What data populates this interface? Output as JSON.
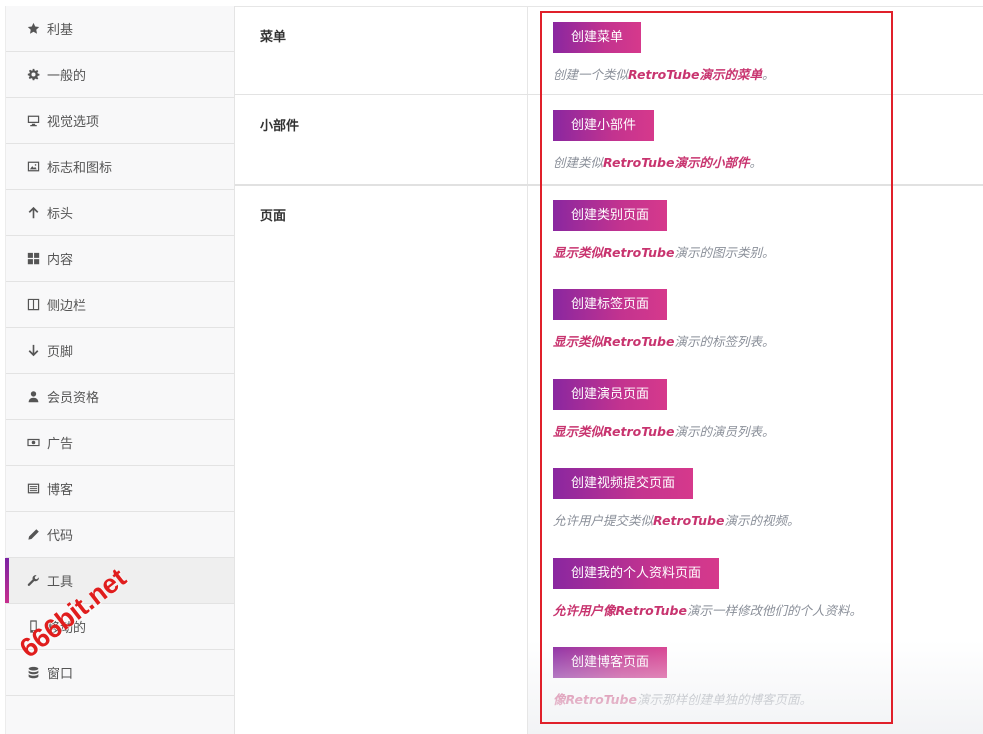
{
  "sidebar": {
    "items": [
      {
        "label": "利基",
        "icon": "star-icon"
      },
      {
        "label": "一般的",
        "icon": "gear-icon"
      },
      {
        "label": "视觉选项",
        "icon": "monitor-icon"
      },
      {
        "label": "标志和图标",
        "icon": "image-icon"
      },
      {
        "label": "标头",
        "icon": "arrow-up-icon"
      },
      {
        "label": "内容",
        "icon": "grid-icon"
      },
      {
        "label": "侧边栏",
        "icon": "columns-icon"
      },
      {
        "label": "页脚",
        "icon": "arrow-down-icon"
      },
      {
        "label": "会员资格",
        "icon": "user-icon"
      },
      {
        "label": "广告",
        "icon": "money-icon"
      },
      {
        "label": "博客",
        "icon": "list-icon"
      },
      {
        "label": "代码",
        "icon": "pencil-icon"
      },
      {
        "label": "工具",
        "icon": "wrench-icon",
        "active": true
      },
      {
        "label": "移动的",
        "icon": "mobile-icon"
      },
      {
        "label": "窗口",
        "icon": "database-icon"
      }
    ]
  },
  "sections": {
    "menu": {
      "label": "菜单",
      "button": "创建菜单",
      "desc_pre": "创建一个类似",
      "desc_hl": "RetroTube演示的菜单",
      "desc_post": "。"
    },
    "widgets": {
      "label": "小部件",
      "button": "创建小部件",
      "desc_pre": "创建类似",
      "desc_hl": "RetroTube演示的小部件",
      "desc_post": "。"
    },
    "pages": {
      "label": "页面",
      "items": [
        {
          "button": "创建类别页面",
          "desc_pre": "",
          "desc_hl": "显示类似RetroTube",
          "desc_post": "演示的图示类别。"
        },
        {
          "button": "创建标签页面",
          "desc_pre": "",
          "desc_hl": "显示类似RetroTube",
          "desc_post": "演示的标签列表。"
        },
        {
          "button": "创建演员页面",
          "desc_pre": "",
          "desc_hl": "显示类似RetroTube",
          "desc_post": "演示的演员列表。"
        },
        {
          "button": "创建视频提交页面",
          "desc_pre": "允许用户提交类似",
          "desc_hl": "RetroTube",
          "desc_post": "演示的视频。"
        },
        {
          "button": "创建我的个人资料页面",
          "desc_pre": "",
          "desc_hl": "允许用户像RetroTube",
          "desc_post": "演示一样修改他们的个人资料。"
        },
        {
          "button": "创建博客页面",
          "desc_pre": "",
          "desc_hl": "像RetroTube",
          "desc_post": "演示那样创建单独的博客页面。"
        }
      ]
    }
  },
  "watermark": "666bit.net",
  "colors": {
    "accent_start": "#8a27a0",
    "accent_end": "#d6398c",
    "highlight_text": "#c8346f",
    "annotation_box": "#e0202a"
  }
}
